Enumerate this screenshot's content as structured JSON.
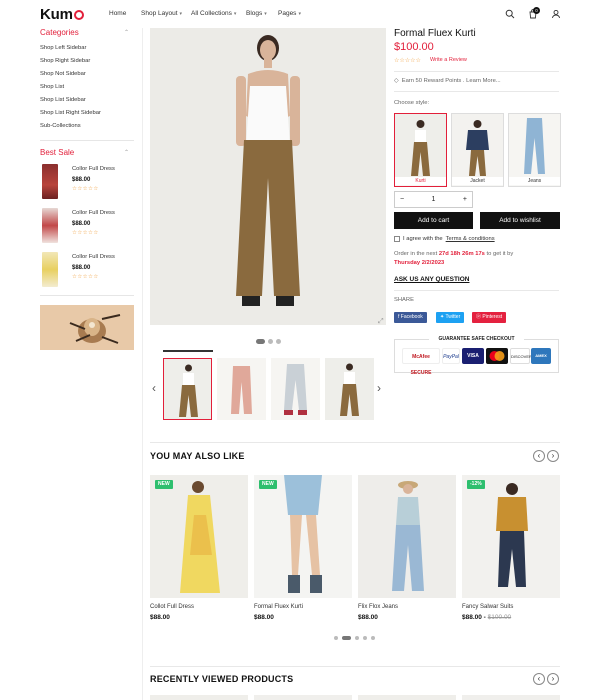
{
  "header": {
    "logo": "Kum",
    "nav": [
      {
        "label": "Home",
        "has_dropdown": false
      },
      {
        "label": "Shop Layout",
        "has_dropdown": true
      },
      {
        "label": "All Collections",
        "has_dropdown": true
      },
      {
        "label": "Blogs",
        "has_dropdown": true
      },
      {
        "label": "Pages",
        "has_dropdown": true
      }
    ],
    "cart_count": "0"
  },
  "sidebar": {
    "categories_title": "Categories",
    "categories": [
      "Shop Left Sidebar",
      "Shop Right Sidebar",
      "Shop Not Sidebar",
      "Shop List",
      "Shop List Sidebar",
      "Shop List Right Sidebar",
      "Sub-Collections"
    ],
    "best_sale_title": "Best Sale",
    "best_sale": [
      {
        "name": "Collor Full Dress",
        "price": "$88.00",
        "stars": "☆☆☆☆☆"
      },
      {
        "name": "Collor Full Dress",
        "price": "$88.00",
        "stars": "☆☆☆☆☆"
      },
      {
        "name": "Collor Full Dress",
        "price": "$88.00",
        "stars": "☆☆☆☆☆"
      }
    ]
  },
  "product": {
    "title": "Formal Fluex Kurti",
    "price": "$100.00",
    "stars": "☆☆☆☆☆",
    "write_review": "Write a Review",
    "reward_text": "Earn 50 Reward Points . Learn More...",
    "choose_style": "Choose style:",
    "styles": [
      "Kurti",
      "Jacket",
      "Jeans"
    ],
    "quantity": "1",
    "add_to_cart": "Add to cart",
    "add_to_wishlist": "Add to wishlist",
    "agree_prefix": "I agree with the",
    "agree_link": "Terms & conditions",
    "order_prefix": "Order in the next",
    "order_countdown": "27d 18h 26m 17s",
    "order_mid": "to get it by",
    "order_date": "Thursday 2/2/2023",
    "ask_question": "ASK US ANY QUESTION",
    "share_label": "SHARE",
    "share_buttons": [
      "Facebook",
      "Twitter",
      "Pinterest"
    ],
    "checkout_title": "GUARANTEE SAFE CHECKOUT",
    "payments": [
      "McAfee SECURE",
      "PayPal",
      "VISA",
      "",
      "DISCOVER",
      "AMEX"
    ]
  },
  "you_may_also_like": {
    "title": "YOU MAY ALSO LIKE",
    "items": [
      {
        "name": "Collot Full Dress",
        "price": "$88.00",
        "old_price": "",
        "badge": "NEW"
      },
      {
        "name": "Formal Fluex Kurti",
        "price": "$88.00",
        "old_price": "",
        "badge": "NEW"
      },
      {
        "name": "Flix Flox Jeans",
        "price": "$88.00",
        "old_price": "",
        "badge": ""
      },
      {
        "name": "Fancy Salwar Suits",
        "price": "$88.00 -",
        "old_price": "$100.00",
        "badge": "-12%"
      }
    ]
  },
  "recently_viewed": {
    "title": "RECENTLY VIEWED PRODUCTS"
  },
  "colors": {
    "accent": "#e21f3a",
    "star": "#f0a040",
    "new_badge": "#2ebf6e",
    "facebook": "#3b5998",
    "twitter": "#1da1f2",
    "pinterest": "#e4213f"
  }
}
